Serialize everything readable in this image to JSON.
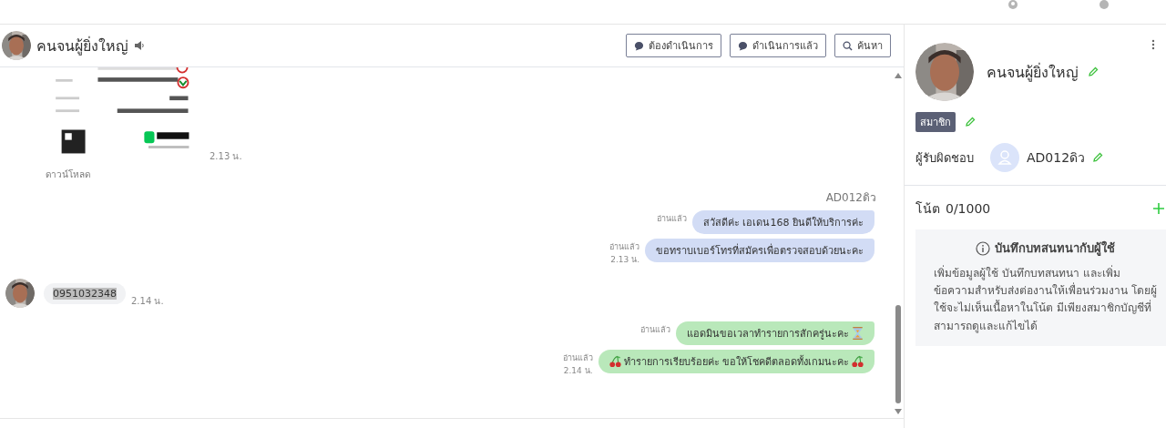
{
  "header": {
    "name": "คนจนผู้ยิ่งใหญ่",
    "buttons": [
      {
        "label": "ต้องดำเนินการ"
      },
      {
        "label": "ดำเนินการแล้ว"
      },
      {
        "label": "ค้นหา"
      }
    ]
  },
  "messages": [
    {
      "time": "2.13 น.",
      "link": "ดาวน์โหลด"
    },
    {
      "kind": "sender",
      "text": "AD012ดิว"
    },
    {
      "kind": "agent",
      "text": "สวัสดีค่ะ เอเดน168 ยินดีให้บริการค่ะ",
      "read": "อ่านแล้ว",
      "color": "#d2dcf5"
    },
    {
      "kind": "agent",
      "text": "ขอทราบเบอร์โทรที่สมัครเพื่อตรวจสอบด้วยนะคะ",
      "read": "อ่านแล้ว",
      "time": "2.13 น.",
      "color": "#d2dcf5"
    },
    {
      "kind": "customer",
      "text": "0951032348",
      "time": "2.14 น.",
      "highlighted": true
    },
    {
      "kind": "agent-hourglass",
      "text": "แอดมินขอเวลาทำรายการสักครู่นะคะ",
      "read": "อ่านแล้ว",
      "color": "#b9e8ba"
    },
    {
      "kind": "agent-cherry",
      "text": "ทำรายการเรียบร้อยค่ะ ขอให้โชคดีตลอดทั้งเกมนะคะ",
      "read": "อ่านแล้ว",
      "time": "2.14 น.",
      "color": "#b9e8ba"
    }
  ],
  "profile": {
    "name": "คนจนผู้ยิ่งใหญ่",
    "tag": "สมาชิก",
    "assignee_label": "ผู้รับผิดชอบ",
    "assignee": "AD012ดิว"
  },
  "notes": {
    "title": "โน้ต",
    "count": "0/1000",
    "info_title": "บันทึกบทสนทนากับผู้ใช้",
    "info_text": "เพิ่มข้อมูลผู้ใช้ บันทึกบทสนทนา และเพิ่มข้อความสำหรับส่งต่องานให้เพื่อนร่วมงาน โดยผู้ใช้จะไม่เห็นเนื้อหาในโน้ต มีเพียงสมาชิกบัญชีที่สามารถดูและแก้ไขได้"
  }
}
